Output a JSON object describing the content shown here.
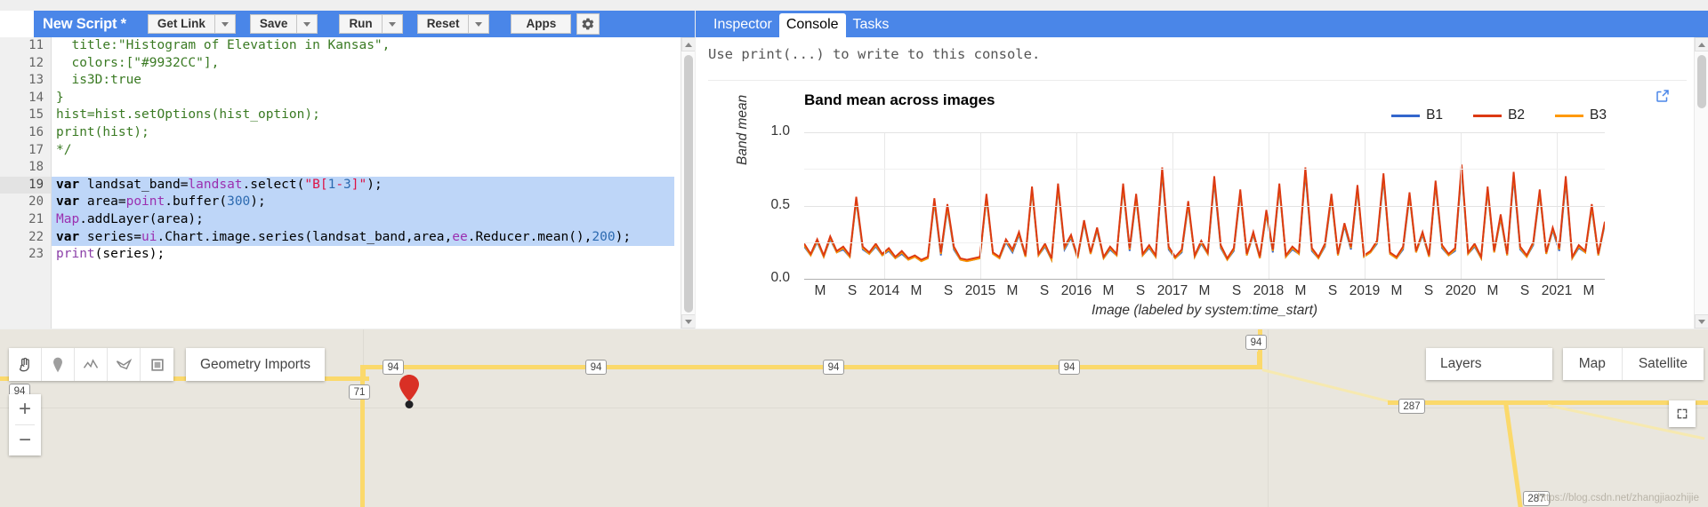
{
  "editor": {
    "script_title": "New Script *",
    "buttons": [
      {
        "label": "Get Link",
        "name": "get-link-button"
      },
      {
        "label": "Save",
        "name": "save-button"
      },
      {
        "label": "Run",
        "name": "run-button"
      },
      {
        "label": "Reset",
        "name": "reset-button"
      },
      {
        "label": "Apps",
        "name": "apps-button"
      }
    ],
    "gear_icon": "gear-icon",
    "accent_color": "#4a86e8",
    "first_visible_line": 11,
    "active_line": 19,
    "selected_lines": [
      19,
      20,
      21,
      22
    ],
    "lines": [
      {
        "n": 11,
        "text": "  title:\"Histogram of Elevation in Kansas\","
      },
      {
        "n": 12,
        "text": "  colors:[\"#9932CC\"],"
      },
      {
        "n": 13,
        "text": "  is3D:true"
      },
      {
        "n": 14,
        "text": "}"
      },
      {
        "n": 15,
        "text": "hist=hist.setOptions(hist_option);"
      },
      {
        "n": 16,
        "text": "print(hist);"
      },
      {
        "n": 17,
        "text": "*/"
      },
      {
        "n": 18,
        "text": ""
      },
      {
        "n": 19,
        "text": "var landsat_band=landsat.select(\"B[1-3]\");"
      },
      {
        "n": 20,
        "text": "var area=point.buffer(300);"
      },
      {
        "n": 21,
        "text": "Map.addLayer(area);"
      },
      {
        "n": 22,
        "text": "var series=ui.Chart.image.series(landsat_band,area,ee.Reducer.mean(),200);"
      },
      {
        "n": 23,
        "text": "print(series);"
      }
    ]
  },
  "console": {
    "tabs": [
      {
        "label": "Inspector",
        "name": "tab-inspector",
        "active": false
      },
      {
        "label": "Console",
        "name": "tab-console",
        "active": true
      },
      {
        "label": "Tasks",
        "name": "tab-tasks",
        "active": false
      }
    ],
    "hint": "Use print(...) to write to this console.",
    "expand_icon": "open-in-new-icon"
  },
  "chart_data": {
    "type": "line",
    "title": "Band mean across images",
    "xlabel": "Image (labeled by system:time_start)",
    "ylabel": "Band mean",
    "ylim": [
      0.0,
      1.0
    ],
    "yticks": [
      "0.0",
      "0.5",
      "1.0"
    ],
    "grid": true,
    "legend_position": "top-right",
    "xticks": [
      "M",
      "S",
      "2014",
      "M",
      "S",
      "2015",
      "M",
      "S",
      "2016",
      "M",
      "S",
      "2017",
      "M",
      "S",
      "2018",
      "M",
      "S",
      "2019",
      "M",
      "S",
      "2020",
      "M",
      "S",
      "2021",
      "M"
    ],
    "series": [
      {
        "name": "B1",
        "color": "#3366cc",
        "values": [
          0.22,
          0.16,
          0.25,
          0.15,
          0.27,
          0.18,
          0.2,
          0.15,
          0.53,
          0.2,
          0.17,
          0.22,
          0.16,
          0.19,
          0.14,
          0.17,
          0.13,
          0.15,
          0.12,
          0.14,
          0.52,
          0.16,
          0.48,
          0.2,
          0.13,
          0.12,
          0.13,
          0.14,
          0.55,
          0.17,
          0.14,
          0.25,
          0.18,
          0.3,
          0.15,
          0.6,
          0.16,
          0.22,
          0.13,
          0.62,
          0.2,
          0.28,
          0.14,
          0.38,
          0.17,
          0.33,
          0.14,
          0.2,
          0.16,
          0.62,
          0.19,
          0.55,
          0.16,
          0.21,
          0.15,
          0.72,
          0.2,
          0.14,
          0.18,
          0.5,
          0.15,
          0.24,
          0.17,
          0.66,
          0.21,
          0.13,
          0.19,
          0.58,
          0.16,
          0.3,
          0.14,
          0.44,
          0.18,
          0.62,
          0.15,
          0.2,
          0.17,
          0.72,
          0.19,
          0.14,
          0.22,
          0.55,
          0.16,
          0.36,
          0.2,
          0.61,
          0.15,
          0.18,
          0.24,
          0.68,
          0.17,
          0.14,
          0.2,
          0.56,
          0.18,
          0.3,
          0.15,
          0.64,
          0.21,
          0.16,
          0.19,
          0.74,
          0.17,
          0.22,
          0.14,
          0.6,
          0.18,
          0.41,
          0.16,
          0.69,
          0.2,
          0.15,
          0.23,
          0.58,
          0.17,
          0.33,
          0.19,
          0.66,
          0.14,
          0.21,
          0.18,
          0.48,
          0.16,
          0.37
        ]
      },
      {
        "name": "B2",
        "color": "#dc3912",
        "values": [
          0.24,
          0.17,
          0.27,
          0.16,
          0.29,
          0.19,
          0.22,
          0.16,
          0.56,
          0.22,
          0.18,
          0.24,
          0.17,
          0.21,
          0.15,
          0.19,
          0.14,
          0.16,
          0.13,
          0.15,
          0.55,
          0.18,
          0.51,
          0.22,
          0.14,
          0.13,
          0.14,
          0.15,
          0.58,
          0.18,
          0.15,
          0.27,
          0.2,
          0.32,
          0.16,
          0.63,
          0.17,
          0.24,
          0.14,
          0.65,
          0.22,
          0.3,
          0.15,
          0.4,
          0.18,
          0.35,
          0.15,
          0.22,
          0.17,
          0.65,
          0.21,
          0.58,
          0.17,
          0.23,
          0.16,
          0.76,
          0.22,
          0.15,
          0.2,
          0.53,
          0.16,
          0.26,
          0.18,
          0.7,
          0.23,
          0.14,
          0.21,
          0.61,
          0.17,
          0.32,
          0.15,
          0.47,
          0.2,
          0.65,
          0.16,
          0.22,
          0.18,
          0.76,
          0.21,
          0.15,
          0.24,
          0.58,
          0.17,
          0.38,
          0.22,
          0.64,
          0.16,
          0.19,
          0.26,
          0.72,
          0.18,
          0.15,
          0.22,
          0.59,
          0.19,
          0.32,
          0.16,
          0.67,
          0.23,
          0.17,
          0.21,
          0.78,
          0.18,
          0.24,
          0.15,
          0.63,
          0.19,
          0.44,
          0.17,
          0.73,
          0.22,
          0.16,
          0.25,
          0.61,
          0.18,
          0.35,
          0.21,
          0.7,
          0.15,
          0.23,
          0.19,
          0.51,
          0.17,
          0.39
        ]
      },
      {
        "name": "B3",
        "color": "#ff9900",
        "values": [
          0.23,
          0.16,
          0.26,
          0.15,
          0.28,
          0.18,
          0.21,
          0.15,
          0.54,
          0.21,
          0.17,
          0.23,
          0.16,
          0.2,
          0.14,
          0.18,
          0.13,
          0.15,
          0.12,
          0.14,
          0.53,
          0.17,
          0.49,
          0.21,
          0.13,
          0.12,
          0.13,
          0.14,
          0.56,
          0.17,
          0.14,
          0.26,
          0.19,
          0.31,
          0.15,
          0.61,
          0.16,
          0.23,
          0.13,
          0.63,
          0.21,
          0.29,
          0.14,
          0.39,
          0.17,
          0.34,
          0.14,
          0.21,
          0.16,
          0.63,
          0.2,
          0.56,
          0.16,
          0.22,
          0.15,
          0.74,
          0.21,
          0.14,
          0.19,
          0.51,
          0.15,
          0.25,
          0.17,
          0.68,
          0.22,
          0.13,
          0.2,
          0.59,
          0.16,
          0.31,
          0.14,
          0.45,
          0.19,
          0.63,
          0.15,
          0.21,
          0.17,
          0.74,
          0.2,
          0.14,
          0.23,
          0.56,
          0.16,
          0.37,
          0.21,
          0.62,
          0.15,
          0.18,
          0.25,
          0.7,
          0.17,
          0.14,
          0.21,
          0.57,
          0.18,
          0.31,
          0.15,
          0.65,
          0.22,
          0.16,
          0.2,
          0.76,
          0.17,
          0.23,
          0.14,
          0.61,
          0.18,
          0.42,
          0.16,
          0.71,
          0.21,
          0.15,
          0.24,
          0.59,
          0.17,
          0.34,
          0.2,
          0.68,
          0.14,
          0.22,
          0.18,
          0.49,
          0.16,
          0.38
        ]
      }
    ]
  },
  "map": {
    "geometry_tools": [
      {
        "name": "pan-hand-icon",
        "label": "hand"
      },
      {
        "name": "marker-pin-icon",
        "label": "point"
      },
      {
        "name": "polyline-icon",
        "label": "line"
      },
      {
        "name": "polygon-icon",
        "label": "polygon"
      },
      {
        "name": "rectangle-icon",
        "label": "rectangle"
      }
    ],
    "geometry_imports_label": "Geometry Imports",
    "layers_label": "Layers",
    "map_type": [
      {
        "label": "Map",
        "name": "map-type-map",
        "active": true
      },
      {
        "label": "Satellite",
        "name": "map-type-satellite",
        "active": false
      }
    ],
    "zoom_in": "+",
    "zoom_out": "−",
    "fullscreen_icon": "fullscreen-icon",
    "marker_icon": "map-marker-icon",
    "road_shields": [
      "94",
      "94",
      "94",
      "94",
      "94",
      "94",
      "71",
      "287",
      "287"
    ],
    "watermark": "https://blog.csdn.net/zhangjiaozhijie"
  }
}
